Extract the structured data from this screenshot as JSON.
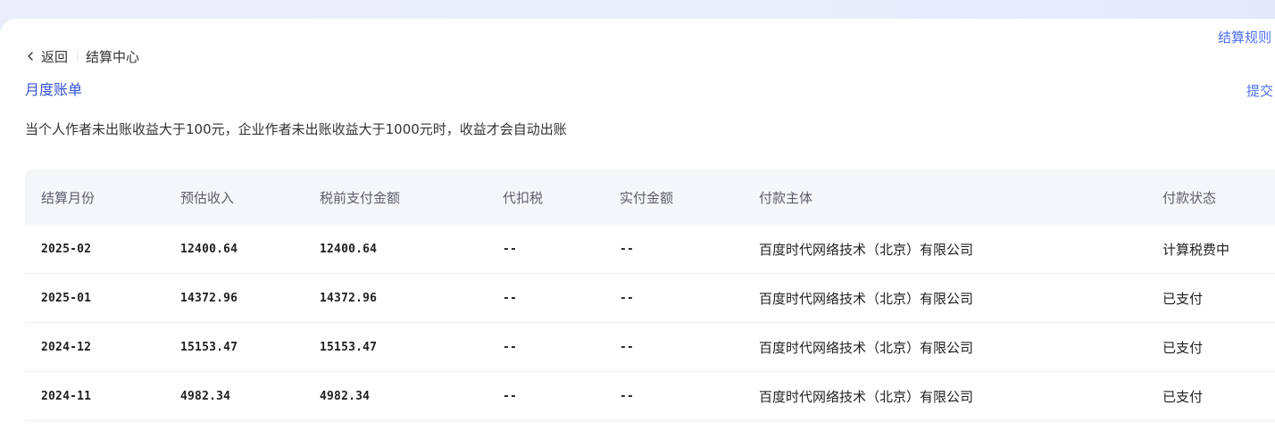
{
  "topbar": {
    "back_label": "返回",
    "page_title": "结算中心",
    "rules_link": "结算规则"
  },
  "section": {
    "title": "月度账单",
    "submit_link": "提交"
  },
  "notice": "当个人作者未出账收益大于100元，企业作者未出账收益大于1000元时，收益才会自动出账",
  "table": {
    "headers": [
      "结算月份",
      "预估收入",
      "税前支付金额",
      "代扣税",
      "实付金额",
      "付款主体",
      "付款状态"
    ],
    "rows": [
      {
        "month": "2025-02",
        "estimated": "12400.64",
        "pretax": "12400.64",
        "tax": "--",
        "paid": "--",
        "payer": "百度时代网络技术（北京）有限公司",
        "status": "计算税费中"
      },
      {
        "month": "2025-01",
        "estimated": "14372.96",
        "pretax": "14372.96",
        "tax": "--",
        "paid": "--",
        "payer": "百度时代网络技术（北京）有限公司",
        "status": "已支付"
      },
      {
        "month": "2024-12",
        "estimated": "15153.47",
        "pretax": "15153.47",
        "tax": "--",
        "paid": "--",
        "payer": "百度时代网络技术（北京）有限公司",
        "status": "已支付"
      },
      {
        "month": "2024-11",
        "estimated": "4982.34",
        "pretax": "4982.34",
        "tax": "--",
        "paid": "--",
        "payer": "百度时代网络技术（北京）有限公司",
        "status": "已支付"
      }
    ]
  },
  "colors": {
    "link": "#4e6ef2",
    "title": "#3353d6",
    "header_bg": "#f5f6f9"
  }
}
